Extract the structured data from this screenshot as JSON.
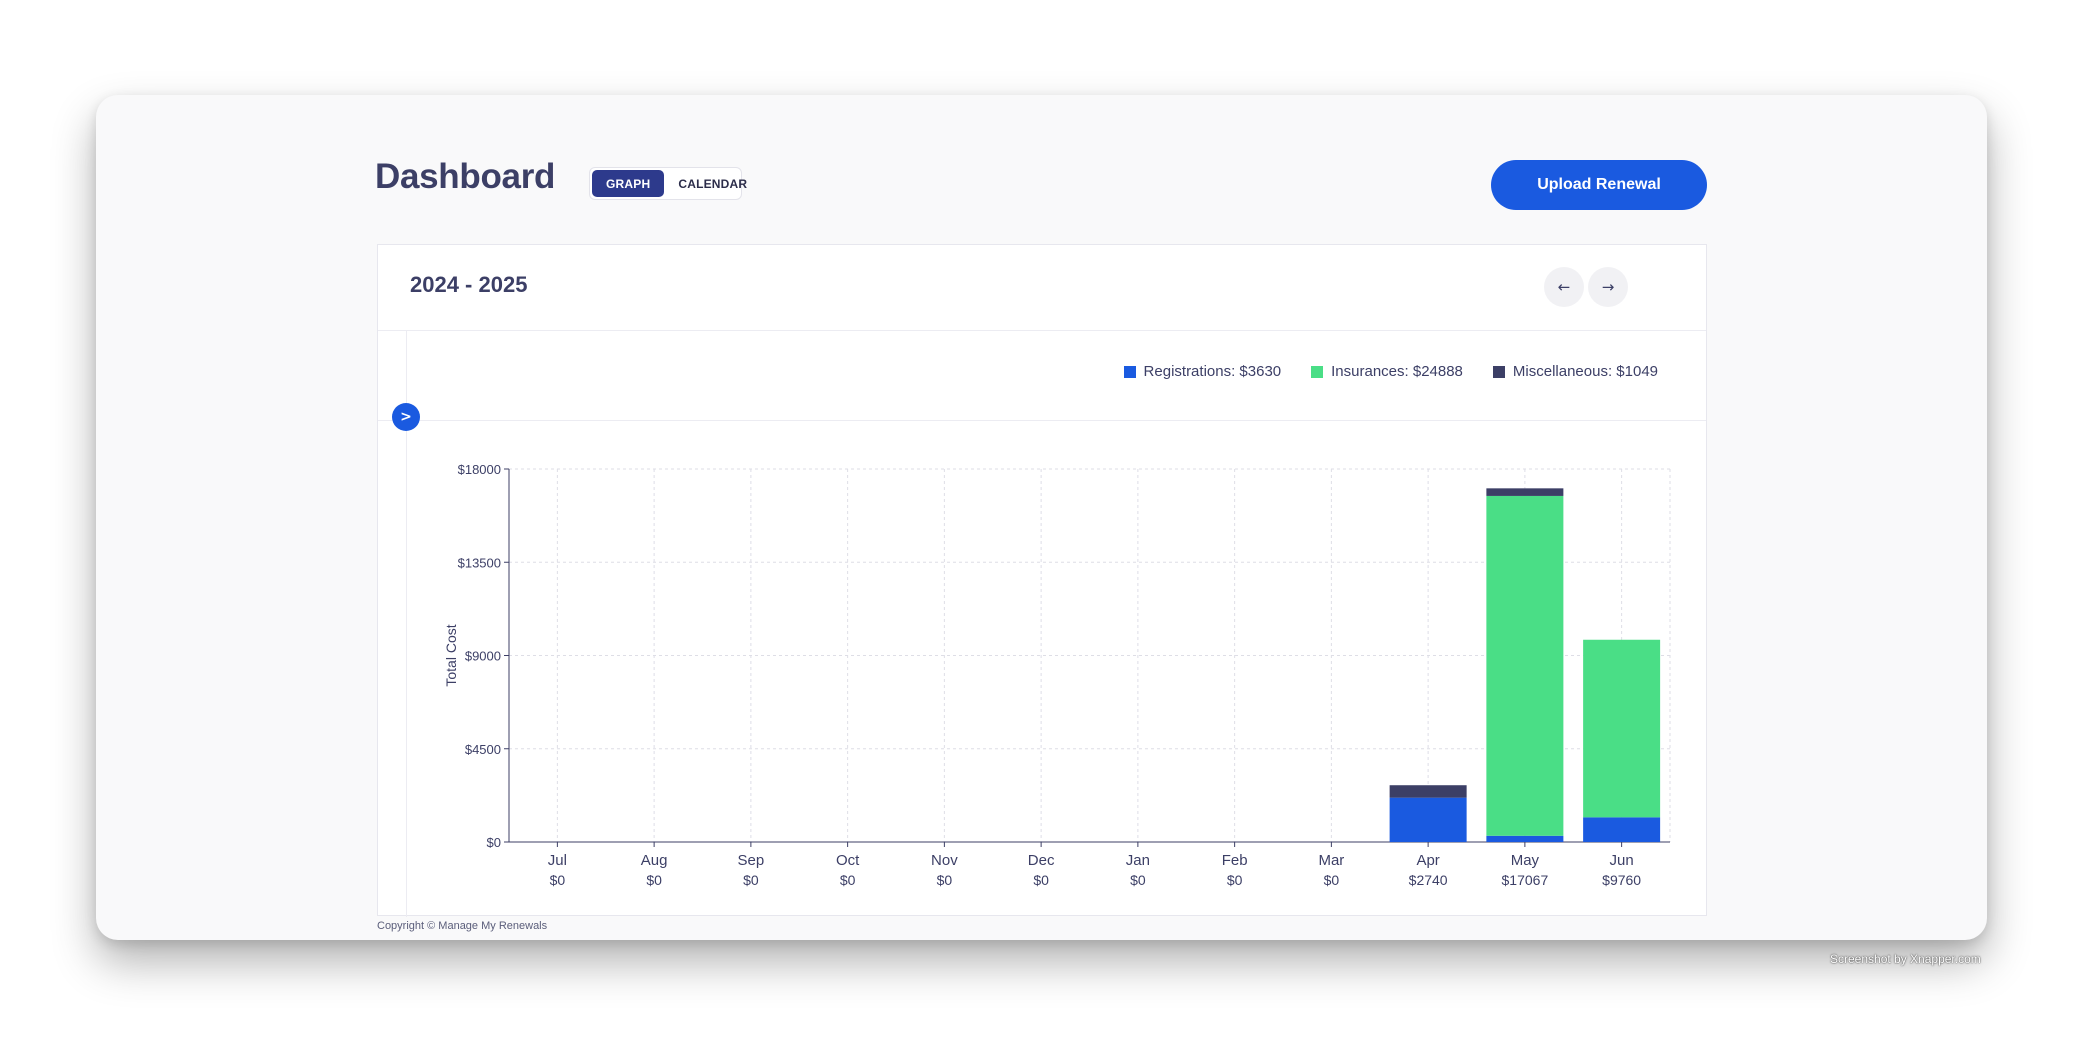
{
  "header": {
    "title": "Dashboard",
    "view_toggle": {
      "graph_label": "GRAPH",
      "calendar_label": "CALENDAR",
      "active": "GRAPH"
    },
    "upload_label": "Upload Renewal"
  },
  "card": {
    "fiscal_year": "2024 - 2025",
    "prev_icon": "arrow-left-icon",
    "next_icon": "arrow-right-icon",
    "expand_icon": "chevron-right-icon",
    "prev_glyph": "←",
    "next_glyph": "→",
    "expand_glyph": ">"
  },
  "legend": [
    {
      "label": "Registrations: $3630",
      "color": "#1a5ae0"
    },
    {
      "label": "Insurances: $24888",
      "color": "#4ade86"
    },
    {
      "label": "Miscellaneous: $1049",
      "color": "#3c3f66"
    }
  ],
  "chart_data": {
    "type": "bar",
    "stacked": true,
    "ylabel": "Total Cost",
    "ylim": [
      0,
      18000
    ],
    "yticks": [
      "$0",
      "$4500",
      "$9000",
      "$13500",
      "$18000"
    ],
    "ytick_values": [
      0,
      4500,
      9000,
      13500,
      18000
    ],
    "categories": [
      "Jul",
      "Aug",
      "Sep",
      "Oct",
      "Nov",
      "Dec",
      "Jan",
      "Feb",
      "Mar",
      "Apr",
      "May",
      "Jun"
    ],
    "totals_labels": [
      "$0",
      "$0",
      "$0",
      "$0",
      "$0",
      "$0",
      "$0",
      "$0",
      "$0",
      "$2740",
      "$17067",
      "$9760"
    ],
    "series": [
      {
        "name": "Registrations",
        "color": "#1a5ae0",
        "values": [
          0,
          0,
          0,
          0,
          0,
          0,
          0,
          0,
          0,
          2140,
          300,
          1190
        ]
      },
      {
        "name": "Insurances",
        "color": "#4ade86",
        "values": [
          0,
          0,
          0,
          0,
          0,
          0,
          0,
          0,
          0,
          0,
          16400,
          8570
        ]
      },
      {
        "name": "Miscellaneous",
        "color": "#3c3f66",
        "values": [
          0,
          0,
          0,
          0,
          0,
          0,
          0,
          0,
          0,
          600,
          367,
          0
        ]
      }
    ],
    "grid": true
  },
  "footer": {
    "copyright": "Copyright © Manage My Renewals"
  },
  "help": {
    "label": "?"
  },
  "watermark": "Screenshot by Xnapper.com"
}
